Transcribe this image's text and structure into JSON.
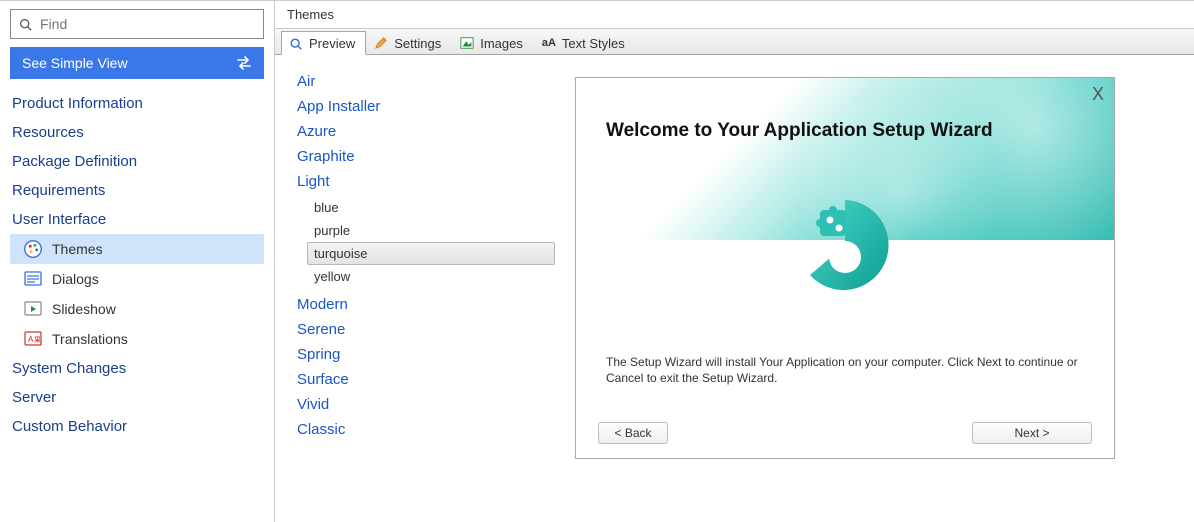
{
  "search": {
    "placeholder": "Find"
  },
  "simple_view_label": "See Simple View",
  "nav": {
    "product_info": "Product Information",
    "resources": "Resources",
    "package_def": "Package Definition",
    "requirements": "Requirements",
    "ui": "User Interface",
    "ui_items": {
      "themes": "Themes",
      "dialogs": "Dialogs",
      "slideshow": "Slideshow",
      "translations": "Translations"
    },
    "system_changes": "System Changes",
    "server": "Server",
    "custom_behavior": "Custom Behavior"
  },
  "main": {
    "title": "Themes",
    "tabs": {
      "preview": "Preview",
      "settings": "Settings",
      "images": "Images",
      "text_styles": "Text Styles"
    },
    "themes": {
      "air": "Air",
      "app_installer": "App Installer",
      "azure": "Azure",
      "graphite": "Graphite",
      "light": "Light",
      "light_variants": {
        "blue": "blue",
        "purple": "purple",
        "turquoise": "turquoise",
        "yellow": "yellow"
      },
      "modern": "Modern",
      "serene": "Serene",
      "spring": "Spring",
      "surface": "Surface",
      "vivid": "Vivid",
      "classic": "Classic"
    }
  },
  "wizard": {
    "close": "X",
    "title": "Welcome to Your Application Setup Wizard",
    "body": "The Setup Wizard will install Your Application on your computer. Click Next to continue or Cancel to exit the Setup Wizard.",
    "back": "< Back",
    "next": "Next >"
  }
}
